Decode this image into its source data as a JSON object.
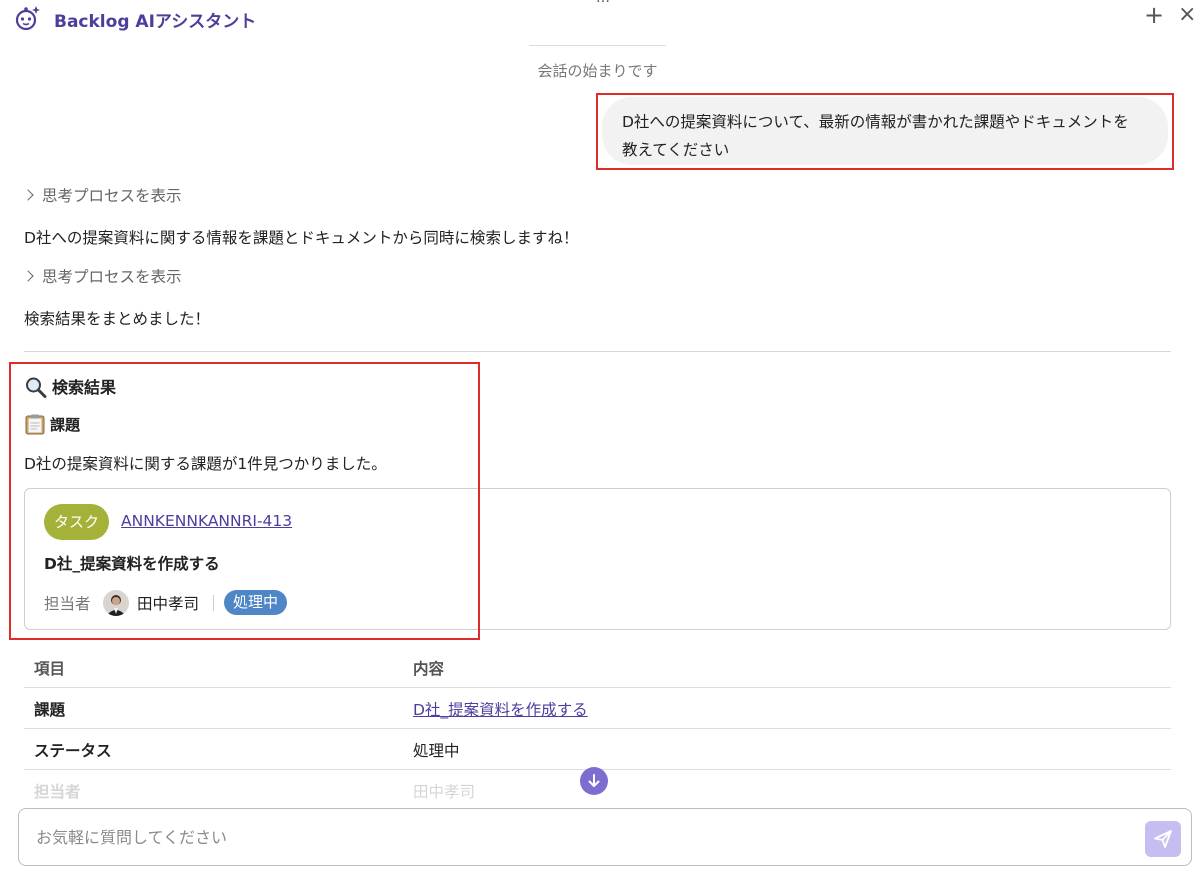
{
  "header": {
    "title": "Backlog AIアシスタント",
    "drag_handle": "…",
    "new_chat_label": "+",
    "close_label": "×"
  },
  "conversation": {
    "start_text": "会話の始まりです",
    "user_message": "D社への提案資料について、最新の情報が書かれた課題やドキュメントを教えてください",
    "think_label_1": "思考プロセスを表示",
    "assistant_message_1": "D社への提案資料に関する情報を課題とドキュメントから同時に検索しますね！",
    "think_label_2": "思考プロセスを表示",
    "assistant_message_2": "検索結果をまとめました！"
  },
  "results": {
    "heading": "検索結果",
    "issues_heading": "課題",
    "found_text": "D社の提案資料に関する課題が1件見つかりました。",
    "card": {
      "type_label": "タスク",
      "type_color": "#a5b23a",
      "issue_key": "ANNKENNKANNRI-413",
      "title": "D社_提案資料を作成する",
      "assignee_label": "担当者",
      "assignee_name": "田中孝司",
      "status": "処理中",
      "status_color": "#4f87c6"
    },
    "table": {
      "headers": [
        "項目",
        "内容"
      ],
      "rows": [
        {
          "label": "課題",
          "value": "D社_提案資料を作成する"
        },
        {
          "label": "ステータス",
          "value": "処理中"
        },
        {
          "label": "担当者",
          "value": "田中孝司"
        }
      ]
    }
  },
  "input": {
    "placeholder": "お気軽に質問してください",
    "value": ""
  },
  "colors": {
    "brand": "#4b3f9e",
    "accent": "#7d6dd0",
    "highlight_border": "#e02b2b"
  }
}
